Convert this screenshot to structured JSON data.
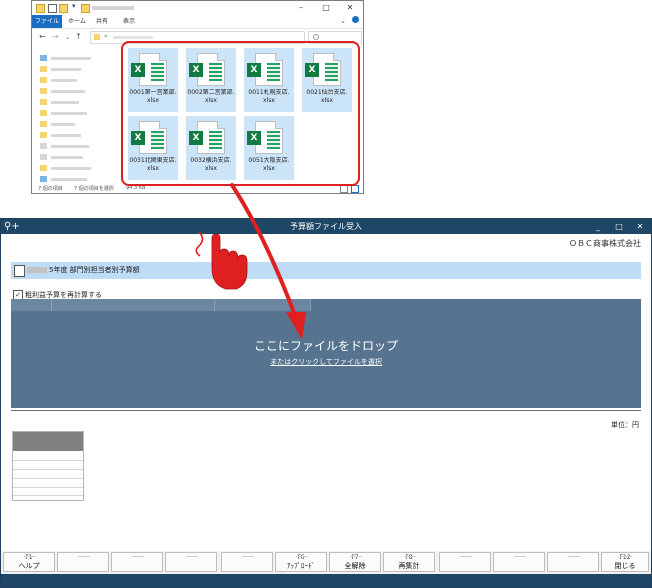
{
  "explorer": {
    "ribbon": {
      "file": "ファイル",
      "home": "ホーム",
      "share": "共有",
      "view": "表示"
    },
    "files": [
      {
        "line1": "0001第一営業部.",
        "line2": "xlsx"
      },
      {
        "line1": "0002第二営業部.",
        "line2": "xlsx"
      },
      {
        "line1": "0011札幌支店.",
        "line2": "xlsx"
      },
      {
        "line1": "0021仙台支店.",
        "line2": "xlsx"
      },
      {
        "line1": "0031北関東支店.",
        "line2": "xlsx"
      },
      {
        "line1": "0032横浜支店.",
        "line2": "xlsx"
      },
      {
        "line1": "0051大阪支店.",
        "line2": "xlsx"
      }
    ],
    "status": {
      "count": "7 個の項目",
      "selected": "7 個の項目を選択",
      "size": "94.3 KB"
    },
    "file_icon_label": "X"
  },
  "app": {
    "logo": "⚲+",
    "title": "予算額ファイル受入",
    "company": "ＯＢＣ商事株式会社",
    "header_title": "5年度 部門別担当者別予算額",
    "recalc_label": "粗利益予算を再計算する",
    "recalc_checked": "✓",
    "dropzone": {
      "main": "ここにファイルをドロップ",
      "sub": "またはクリックしてファイルを選択"
    },
    "unit": "単位：円",
    "window_buttons": {
      "minimize": "_",
      "maximize": "□",
      "close": "✕"
    }
  },
  "fkeys": [
    {
      "num": "F1",
      "label": "ヘルプ"
    },
    {
      "num": "",
      "label": ""
    },
    {
      "num": "",
      "label": ""
    },
    {
      "num": "",
      "label": ""
    },
    {
      "num": "",
      "label": ""
    },
    {
      "num": "F6",
      "label": "ｱｯﾌﾟﾛｰﾄﾞ"
    },
    {
      "num": "F7",
      "label": "全解除"
    },
    {
      "num": "F8",
      "label": "再集計"
    },
    {
      "num": "",
      "label": ""
    },
    {
      "num": "",
      "label": ""
    },
    {
      "num": "",
      "label": ""
    },
    {
      "num": "F12",
      "label": "閉じる"
    }
  ],
  "colors": {
    "title_bar": "#1e4667",
    "header_bar": "#bedcf6",
    "dropzone": "#56748f",
    "highlight": "#e02020",
    "excel_green": "#107c41"
  }
}
